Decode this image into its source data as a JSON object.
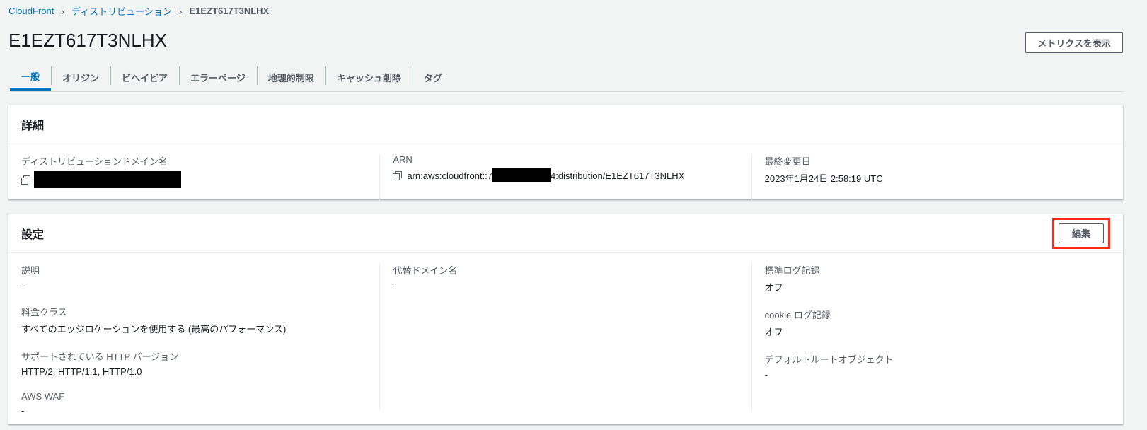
{
  "breadcrumb": [
    "CloudFront",
    "ディストリビューション",
    "E1EZT617T3NLHX"
  ],
  "title": "E1EZT617T3NLHX",
  "metrics_button": "メトリクスを表示",
  "tabs": [
    "一般",
    "オリジン",
    "ビヘイビア",
    "エラーページ",
    "地理的制限",
    "キャッシュ削除",
    "タグ"
  ],
  "details": {
    "heading": "詳細",
    "domain_label": "ディストリビューションドメイン名",
    "arn_label": "ARN",
    "arn_prefix": "arn:aws:cloudfront::7",
    "arn_suffix": "4:distribution/E1EZT617T3NLHX",
    "modified_label": "最終変更日",
    "modified_value": "2023年1月24日 2:58:19 UTC"
  },
  "settings": {
    "heading": "設定",
    "edit_button": "編集",
    "col1": [
      {
        "label": "説明",
        "value": "-"
      },
      {
        "label": "料金クラス",
        "value": "すべてのエッジロケーションを使用する (最高のパフォーマンス)"
      },
      {
        "label": "サポートされている HTTP バージョン",
        "value": "HTTP/2, HTTP/1.1, HTTP/1.0"
      },
      {
        "label": "AWS WAF",
        "value": "-"
      }
    ],
    "col2": [
      {
        "label": "代替ドメイン名",
        "value": "-"
      }
    ],
    "col3": [
      {
        "label": "標準ログ記録",
        "value": "オフ"
      },
      {
        "label": "cookie ログ記録",
        "value": "オフ"
      },
      {
        "label": "デフォルトルートオブジェクト",
        "value": "-"
      }
    ]
  }
}
